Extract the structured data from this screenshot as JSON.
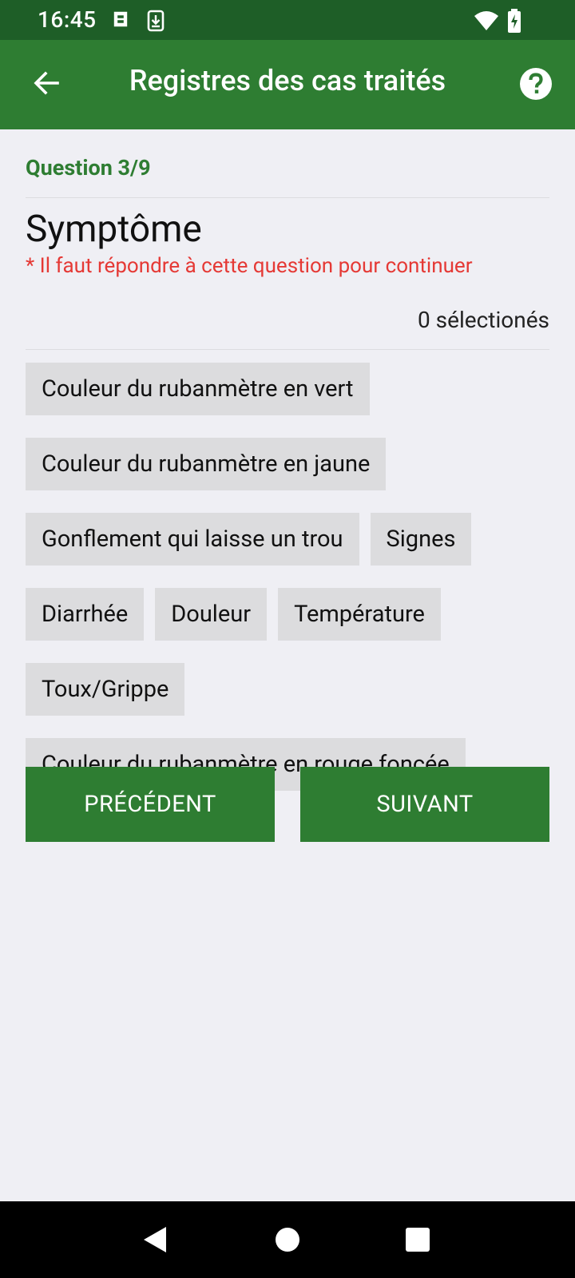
{
  "status_bar": {
    "time": "16:45",
    "icons": [
      "notification-icon",
      "download-icon",
      "wifi-icon",
      "battery-charging-icon"
    ]
  },
  "app_bar": {
    "title": "Registres des cas traités",
    "back_icon": "arrow-back-icon",
    "help_icon": "help-circle-icon"
  },
  "question": {
    "progress": "Question 3/9",
    "title": "Symptôme",
    "required_message": "* Il faut répondre  à cette question pour continuer",
    "selected_count": "0 sélectionés"
  },
  "options": [
    "Couleur du rubanmètre en vert",
    "Couleur du rubanmètre en jaune",
    "Gonflement qui laisse un trou",
    "Signes",
    "Diarrhée",
    "Douleur",
    "Température",
    "Toux/Grippe",
    "Couleur du rubanmètre en rouge foncée"
  ],
  "buttons": {
    "previous": "PRÉCÉDENT",
    "next": "SUIVANT"
  },
  "system_nav": {
    "back": "back-triangle-icon",
    "home": "home-circle-icon",
    "recents": "recents-square-icon"
  },
  "colors": {
    "primary": "#2e7d32",
    "status_bar": "#1e5e27",
    "error": "#e53935",
    "chip_bg": "#dcdcde",
    "background": "#efeff4"
  }
}
